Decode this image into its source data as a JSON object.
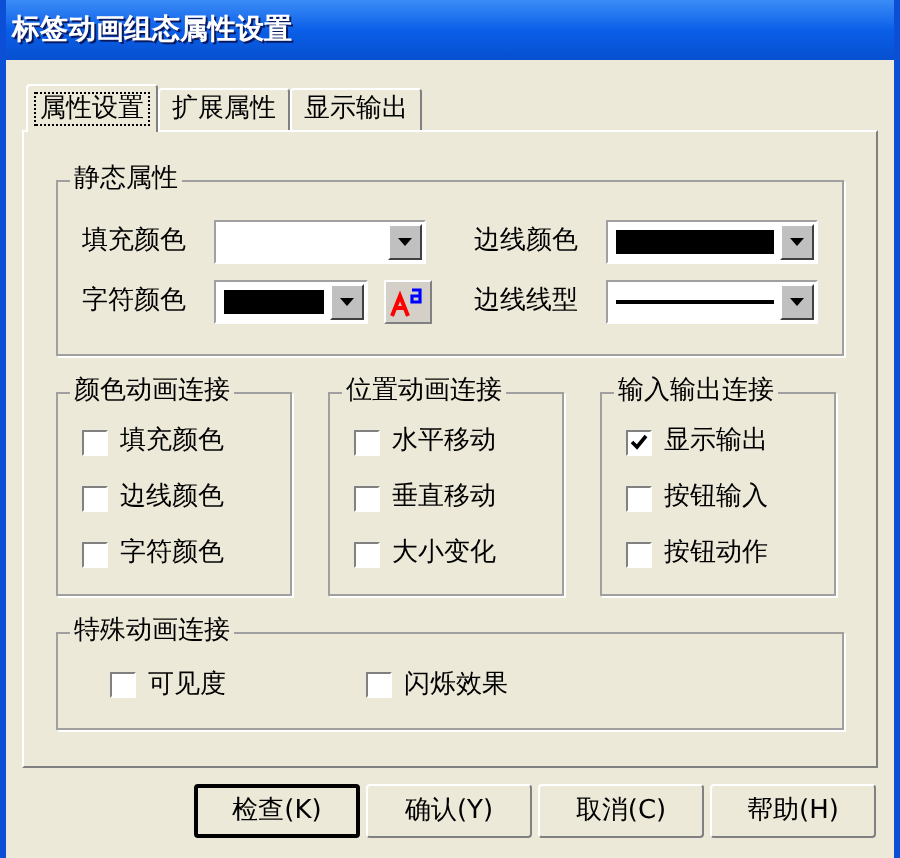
{
  "window": {
    "title": "标签动画组态属性设置"
  },
  "tabs": [
    {
      "label": "属性设置",
      "selected": true
    },
    {
      "label": "扩展属性",
      "selected": false
    },
    {
      "label": "显示输出",
      "selected": false
    }
  ],
  "static": {
    "title": "静态属性",
    "fields": [
      {
        "label": "填充颜色",
        "kind": "color",
        "color": "#ffffff"
      },
      {
        "label": "边线颜色",
        "kind": "color",
        "color": "#000000"
      },
      {
        "label": "字符颜色",
        "kind": "fontcolor",
        "color": "#000000"
      },
      {
        "label": "边线线型",
        "kind": "line"
      }
    ]
  },
  "groups": [
    {
      "title": "颜色动画连接",
      "items": [
        {
          "label": "填充颜色",
          "checked": false
        },
        {
          "label": "边线颜色",
          "checked": false
        },
        {
          "label": "字符颜色",
          "checked": false
        }
      ]
    },
    {
      "title": "位置动画连接",
      "items": [
        {
          "label": "水平移动",
          "checked": false
        },
        {
          "label": "垂直移动",
          "checked": false
        },
        {
          "label": "大小变化",
          "checked": false
        }
      ]
    },
    {
      "title": "输入输出连接",
      "items": [
        {
          "label": "显示输出",
          "checked": true
        },
        {
          "label": "按钮输入",
          "checked": false
        },
        {
          "label": "按钮动作",
          "checked": false
        }
      ]
    }
  ],
  "special": {
    "title": "特殊动画连接",
    "items": [
      {
        "label": "可见度",
        "checked": false
      },
      {
        "label": "闪烁效果",
        "checked": false
      }
    ]
  },
  "buttons": [
    {
      "label": "检查(K)",
      "default": true
    },
    {
      "label": "确认(Y)",
      "default": false
    },
    {
      "label": "取消(C)",
      "default": false
    },
    {
      "label": "帮助(H)",
      "default": false
    }
  ]
}
